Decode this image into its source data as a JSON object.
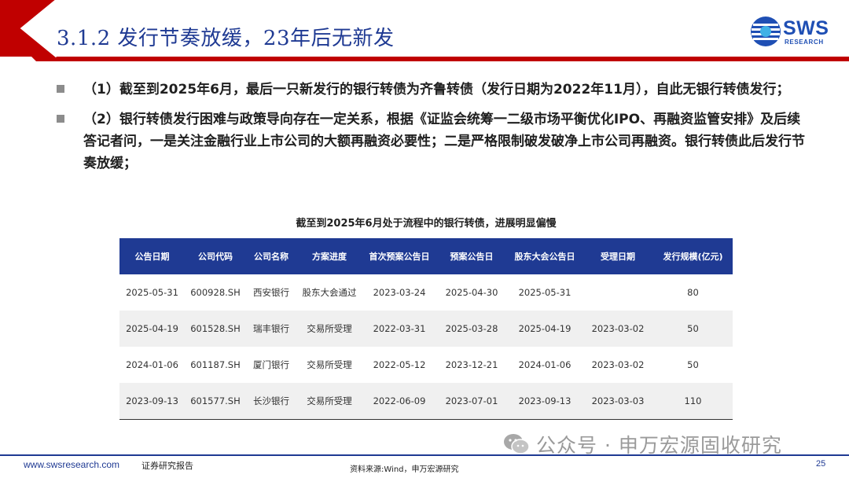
{
  "header": {
    "title": "3.1.2 发行节奏放缓，23年后无新发",
    "logo_text": "SWS",
    "logo_sub": "RESEARCH"
  },
  "bullets": [
    "（1）截至到2025年6月，最后一只新发行的银行转债为齐鲁转债（发行日期为2022年11月），自此无银行转债发行；",
    "（2）银行转债发行困难与政策导向存在一定关系，根据《证监会统筹一二级市场平衡优化IPO、再融资监管安排》及后续答记者问，一是关注金融行业上市公司的大额再融资必要性；二是严格限制破发破净上市公司再融资。银行转债此后发行节奏放缓；"
  ],
  "table": {
    "caption": "截至到2025年6月处于流程中的银行转债，进展明显偏慢",
    "columns": [
      "公告日期",
      "公司代码",
      "公司名称",
      "方案进度",
      "首次预案公告日",
      "预案公告日",
      "股东大会公告日",
      "受理日期",
      "发行规模(亿元)"
    ],
    "rows": [
      [
        "2025-05-31",
        "600928.SH",
        "西安银行",
        "股东大会通过",
        "2023-03-24",
        "2025-04-30",
        "2025-05-31",
        "",
        "80"
      ],
      [
        "2025-04-19",
        "601528.SH",
        "瑞丰银行",
        "交易所受理",
        "2022-03-31",
        "2025-03-28",
        "2025-04-19",
        "2023-03-02",
        "50"
      ],
      [
        "2024-01-06",
        "601187.SH",
        "厦门银行",
        "交易所受理",
        "2022-05-12",
        "2023-12-21",
        "2024-01-06",
        "2023-03-02",
        "50"
      ],
      [
        "2023-09-13",
        "601577.SH",
        "长沙银行",
        "交易所受理",
        "2022-06-09",
        "2023-07-01",
        "2023-09-13",
        "2023-03-03",
        "110"
      ]
    ]
  },
  "watermark": "公众号 · 申万宏源固收研究",
  "footer": {
    "url": "www.swsresearch.com",
    "report_label": "证券研究报告",
    "source": "资料来源:Wind，申万宏源研究",
    "page_number": "25"
  },
  "colors": {
    "primary_blue": "#1f3a93",
    "header_red": "#c00000",
    "logo_blue": "#1f4fb4",
    "row_alt": "#f0f0f0"
  }
}
